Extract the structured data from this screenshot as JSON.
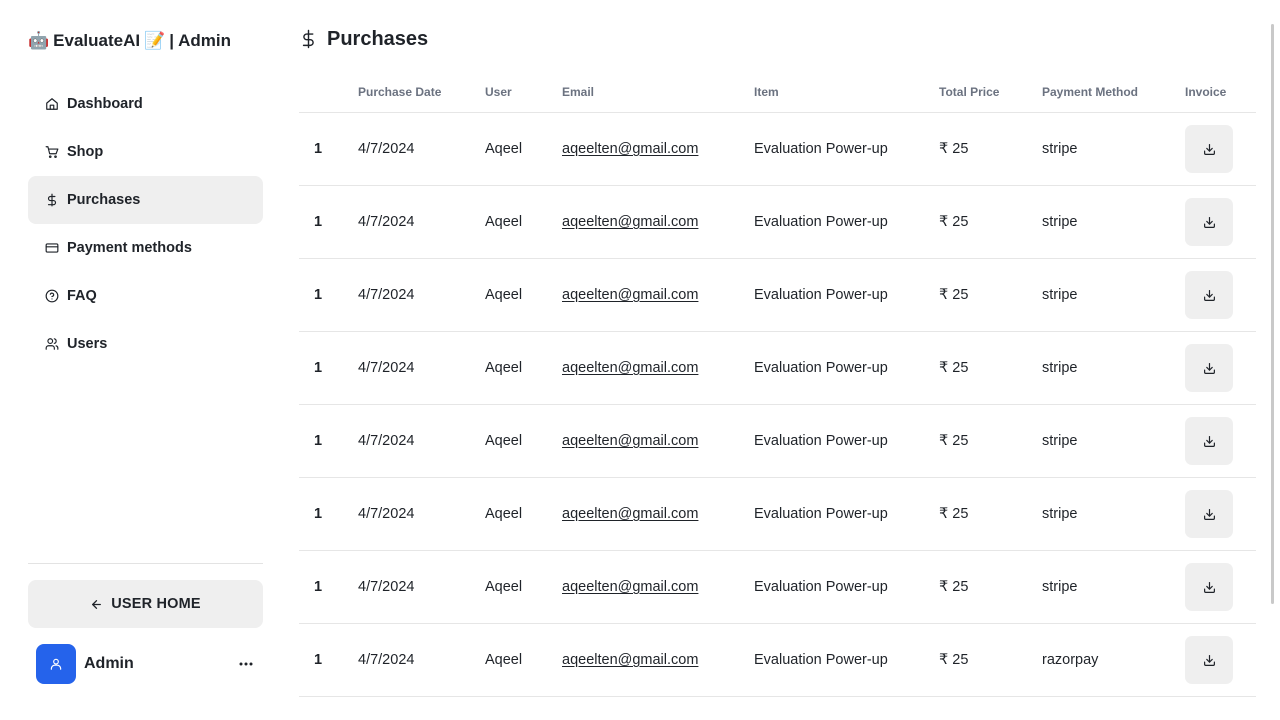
{
  "brand": {
    "robot_emoji": "🤖",
    "name": "EvaluateAI",
    "memo_emoji": "📝",
    "suffix": "| Admin"
  },
  "nav": [
    {
      "label": "Dashboard",
      "icon": "home-icon"
    },
    {
      "label": "Shop",
      "icon": "cart-icon"
    },
    {
      "label": "Purchases",
      "icon": "dollar-icon",
      "active": true
    },
    {
      "label": "Payment methods",
      "icon": "credit-card-icon"
    },
    {
      "label": "FAQ",
      "icon": "help-circle-icon"
    },
    {
      "label": "Users",
      "icon": "users-icon"
    }
  ],
  "user_home": {
    "label": "USER HOME",
    "icon": "arrow-left-icon"
  },
  "profile": {
    "name": "Admin",
    "avatar_color": "#2563eb",
    "menu_icon": "more-horizontal-icon"
  },
  "page": {
    "title": "Purchases",
    "icon": "dollar-icon"
  },
  "table": {
    "headers": [
      "Purchase Date",
      "User",
      "Email",
      "Item",
      "Total Price",
      "Payment Method",
      "Invoice"
    ],
    "rows": [
      {
        "index": "1",
        "date": "4/7/2024",
        "user": "Aqeel",
        "email": "aqeelten@gmail.com",
        "item": "Evaluation Power-up",
        "price": "₹ 25",
        "method": "stripe"
      },
      {
        "index": "1",
        "date": "4/7/2024",
        "user": "Aqeel",
        "email": "aqeelten@gmail.com",
        "item": "Evaluation Power-up",
        "price": "₹ 25",
        "method": "stripe"
      },
      {
        "index": "1",
        "date": "4/7/2024",
        "user": "Aqeel",
        "email": "aqeelten@gmail.com",
        "item": "Evaluation Power-up",
        "price": "₹ 25",
        "method": "stripe"
      },
      {
        "index": "1",
        "date": "4/7/2024",
        "user": "Aqeel",
        "email": "aqeelten@gmail.com",
        "item": "Evaluation Power-up",
        "price": "₹ 25",
        "method": "stripe"
      },
      {
        "index": "1",
        "date": "4/7/2024",
        "user": "Aqeel",
        "email": "aqeelten@gmail.com",
        "item": "Evaluation Power-up",
        "price": "₹ 25",
        "method": "stripe"
      },
      {
        "index": "1",
        "date": "4/7/2024",
        "user": "Aqeel",
        "email": "aqeelten@gmail.com",
        "item": "Evaluation Power-up",
        "price": "₹ 25",
        "method": "stripe"
      },
      {
        "index": "1",
        "date": "4/7/2024",
        "user": "Aqeel",
        "email": "aqeelten@gmail.com",
        "item": "Evaluation Power-up",
        "price": "₹ 25",
        "method": "stripe"
      },
      {
        "index": "1",
        "date": "4/7/2024",
        "user": "Aqeel",
        "email": "aqeelten@gmail.com",
        "item": "Evaluation Power-up",
        "price": "₹ 25",
        "method": "razorpay"
      }
    ],
    "invoice_icon": "download-icon"
  }
}
